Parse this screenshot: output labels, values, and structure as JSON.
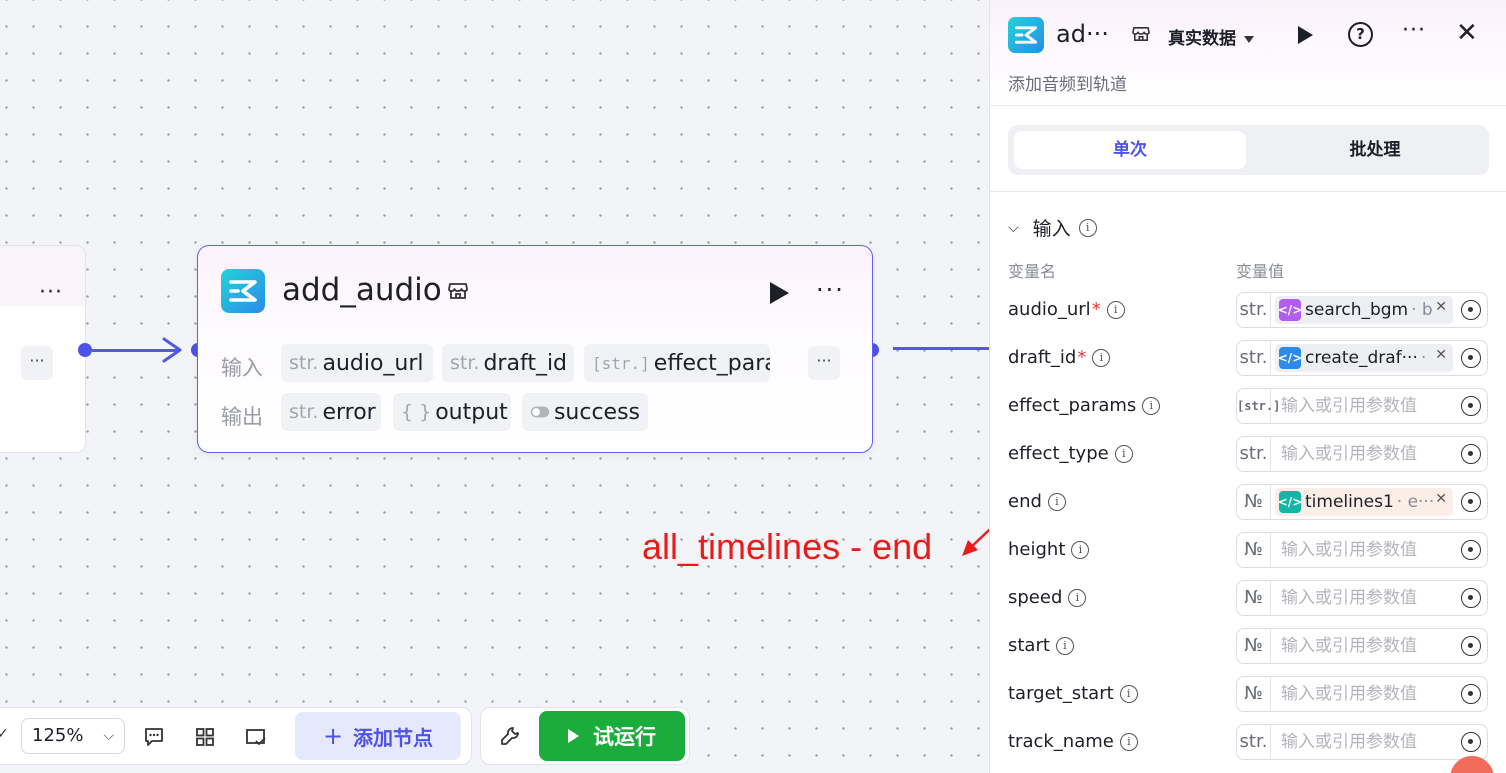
{
  "canvas": {
    "left_node": {
      "more": "···",
      "partial": "·",
      "ellipsis": "···"
    },
    "main_node": {
      "title": "add_audio",
      "more": "···",
      "input_label": "输入",
      "output_label": "输出",
      "inputs": [
        {
          "type": "str.",
          "name": "audio_url"
        },
        {
          "type": "str.",
          "name": "draft_id"
        },
        {
          "type": "[str.]",
          "name": "effect_params"
        }
      ],
      "outputs": [
        {
          "type": "str.",
          "name": "error"
        },
        {
          "type": "{ }",
          "name": "output"
        },
        {
          "type": "toggle",
          "name": "success"
        }
      ],
      "inputs_more": "···"
    },
    "annotation": "all_timelines - end"
  },
  "toolbar": {
    "zoom": "125%",
    "add_node": "添加节点",
    "run": "试运行"
  },
  "panel": {
    "title": "ad···",
    "data_mode": "真实数据",
    "description": "添加音频到轨道",
    "tabs": [
      "单次",
      "批处理"
    ],
    "section": "输入",
    "col_name": "变量名",
    "col_value": "变量值",
    "placeholder": "输入或引用参数值",
    "params": [
      {
        "name": "audio_url",
        "required": true,
        "type": "str.",
        "ref_src": "search_bgm",
        "ref_var": "· b",
        "ref_color": "#b25df0"
      },
      {
        "name": "draft_id",
        "required": true,
        "type": "str.",
        "ref_src": "create_draf···",
        "ref_var": "·",
        "ref_color": "#2a8bea"
      },
      {
        "name": "effect_params",
        "required": false,
        "type": "[str.]"
      },
      {
        "name": "effect_type",
        "required": false,
        "type": "str."
      },
      {
        "name": "end",
        "required": false,
        "type": "№",
        "ref_src": "timelines1",
        "ref_var": "· e···",
        "ref_color": "#12b5a6"
      },
      {
        "name": "height",
        "required": false,
        "type": "№"
      },
      {
        "name": "speed",
        "required": false,
        "type": "№"
      },
      {
        "name": "start",
        "required": false,
        "type": "№"
      },
      {
        "name": "target_start",
        "required": false,
        "type": "№"
      },
      {
        "name": "track_name",
        "required": false,
        "type": "str."
      }
    ]
  }
}
